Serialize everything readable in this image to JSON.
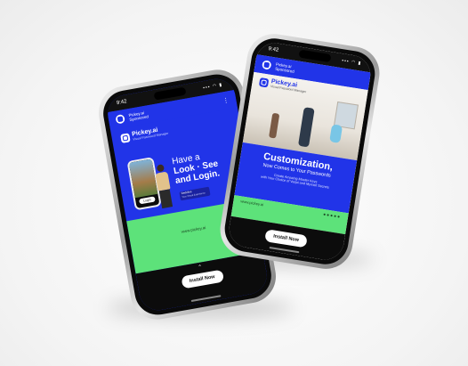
{
  "left_phone": {
    "time": "9:42",
    "signal": "▪▪▪ ◠ ▮",
    "advertiser": {
      "name": "Pickey.ai",
      "label": "Sponsored"
    },
    "brand": {
      "name": "Pickey.ai",
      "tagline": "Visual Password Manager"
    },
    "headline_lines": [
      "Have a",
      "Look · See",
      "and Login."
    ],
    "mini_card_lines": [
      "Redefine",
      "Your Visual Experience"
    ],
    "login_label": "Login",
    "url": "www.pickey.ai",
    "cta": "Install Now"
  },
  "right_phone": {
    "time": "9:42",
    "signal": "▪▪▪ ◠ ▮",
    "advertiser": {
      "name": "Pickey.ai",
      "label": "Sponsored"
    },
    "brand": {
      "name": "Pickey.ai",
      "tagline": "Visual Password Manager"
    },
    "headline": "Customization,",
    "subheadline": "Now Comes to Your Passwords",
    "body_lines": [
      "Create Amazing Master Keys",
      "with Your Choice of Vaqui and Myrnell Secrets"
    ],
    "url": "www.pickey.ai",
    "cta": "Install Now"
  },
  "colors": {
    "primary_blue": "#2134e8",
    "accent_green": "#5de27a",
    "frame_silver": "#c8c8c8"
  }
}
